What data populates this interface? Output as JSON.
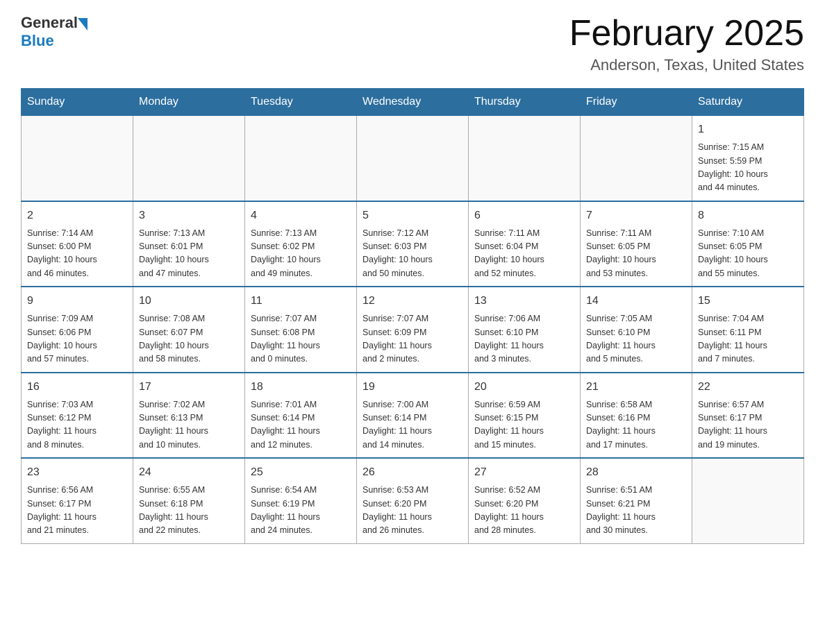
{
  "header": {
    "logo_general": "General",
    "logo_blue": "Blue",
    "month_title": "February 2025",
    "location": "Anderson, Texas, United States"
  },
  "days_of_week": [
    "Sunday",
    "Monday",
    "Tuesday",
    "Wednesday",
    "Thursday",
    "Friday",
    "Saturday"
  ],
  "weeks": [
    [
      {
        "day": "",
        "info": ""
      },
      {
        "day": "",
        "info": ""
      },
      {
        "day": "",
        "info": ""
      },
      {
        "day": "",
        "info": ""
      },
      {
        "day": "",
        "info": ""
      },
      {
        "day": "",
        "info": ""
      },
      {
        "day": "1",
        "info": "Sunrise: 7:15 AM\nSunset: 5:59 PM\nDaylight: 10 hours\nand 44 minutes."
      }
    ],
    [
      {
        "day": "2",
        "info": "Sunrise: 7:14 AM\nSunset: 6:00 PM\nDaylight: 10 hours\nand 46 minutes."
      },
      {
        "day": "3",
        "info": "Sunrise: 7:13 AM\nSunset: 6:01 PM\nDaylight: 10 hours\nand 47 minutes."
      },
      {
        "day": "4",
        "info": "Sunrise: 7:13 AM\nSunset: 6:02 PM\nDaylight: 10 hours\nand 49 minutes."
      },
      {
        "day": "5",
        "info": "Sunrise: 7:12 AM\nSunset: 6:03 PM\nDaylight: 10 hours\nand 50 minutes."
      },
      {
        "day": "6",
        "info": "Sunrise: 7:11 AM\nSunset: 6:04 PM\nDaylight: 10 hours\nand 52 minutes."
      },
      {
        "day": "7",
        "info": "Sunrise: 7:11 AM\nSunset: 6:05 PM\nDaylight: 10 hours\nand 53 minutes."
      },
      {
        "day": "8",
        "info": "Sunrise: 7:10 AM\nSunset: 6:05 PM\nDaylight: 10 hours\nand 55 minutes."
      }
    ],
    [
      {
        "day": "9",
        "info": "Sunrise: 7:09 AM\nSunset: 6:06 PM\nDaylight: 10 hours\nand 57 minutes."
      },
      {
        "day": "10",
        "info": "Sunrise: 7:08 AM\nSunset: 6:07 PM\nDaylight: 10 hours\nand 58 minutes."
      },
      {
        "day": "11",
        "info": "Sunrise: 7:07 AM\nSunset: 6:08 PM\nDaylight: 11 hours\nand 0 minutes."
      },
      {
        "day": "12",
        "info": "Sunrise: 7:07 AM\nSunset: 6:09 PM\nDaylight: 11 hours\nand 2 minutes."
      },
      {
        "day": "13",
        "info": "Sunrise: 7:06 AM\nSunset: 6:10 PM\nDaylight: 11 hours\nand 3 minutes."
      },
      {
        "day": "14",
        "info": "Sunrise: 7:05 AM\nSunset: 6:10 PM\nDaylight: 11 hours\nand 5 minutes."
      },
      {
        "day": "15",
        "info": "Sunrise: 7:04 AM\nSunset: 6:11 PM\nDaylight: 11 hours\nand 7 minutes."
      }
    ],
    [
      {
        "day": "16",
        "info": "Sunrise: 7:03 AM\nSunset: 6:12 PM\nDaylight: 11 hours\nand 8 minutes."
      },
      {
        "day": "17",
        "info": "Sunrise: 7:02 AM\nSunset: 6:13 PM\nDaylight: 11 hours\nand 10 minutes."
      },
      {
        "day": "18",
        "info": "Sunrise: 7:01 AM\nSunset: 6:14 PM\nDaylight: 11 hours\nand 12 minutes."
      },
      {
        "day": "19",
        "info": "Sunrise: 7:00 AM\nSunset: 6:14 PM\nDaylight: 11 hours\nand 14 minutes."
      },
      {
        "day": "20",
        "info": "Sunrise: 6:59 AM\nSunset: 6:15 PM\nDaylight: 11 hours\nand 15 minutes."
      },
      {
        "day": "21",
        "info": "Sunrise: 6:58 AM\nSunset: 6:16 PM\nDaylight: 11 hours\nand 17 minutes."
      },
      {
        "day": "22",
        "info": "Sunrise: 6:57 AM\nSunset: 6:17 PM\nDaylight: 11 hours\nand 19 minutes."
      }
    ],
    [
      {
        "day": "23",
        "info": "Sunrise: 6:56 AM\nSunset: 6:17 PM\nDaylight: 11 hours\nand 21 minutes."
      },
      {
        "day": "24",
        "info": "Sunrise: 6:55 AM\nSunset: 6:18 PM\nDaylight: 11 hours\nand 22 minutes."
      },
      {
        "day": "25",
        "info": "Sunrise: 6:54 AM\nSunset: 6:19 PM\nDaylight: 11 hours\nand 24 minutes."
      },
      {
        "day": "26",
        "info": "Sunrise: 6:53 AM\nSunset: 6:20 PM\nDaylight: 11 hours\nand 26 minutes."
      },
      {
        "day": "27",
        "info": "Sunrise: 6:52 AM\nSunset: 6:20 PM\nDaylight: 11 hours\nand 28 minutes."
      },
      {
        "day": "28",
        "info": "Sunrise: 6:51 AM\nSunset: 6:21 PM\nDaylight: 11 hours\nand 30 minutes."
      },
      {
        "day": "",
        "info": ""
      }
    ]
  ]
}
